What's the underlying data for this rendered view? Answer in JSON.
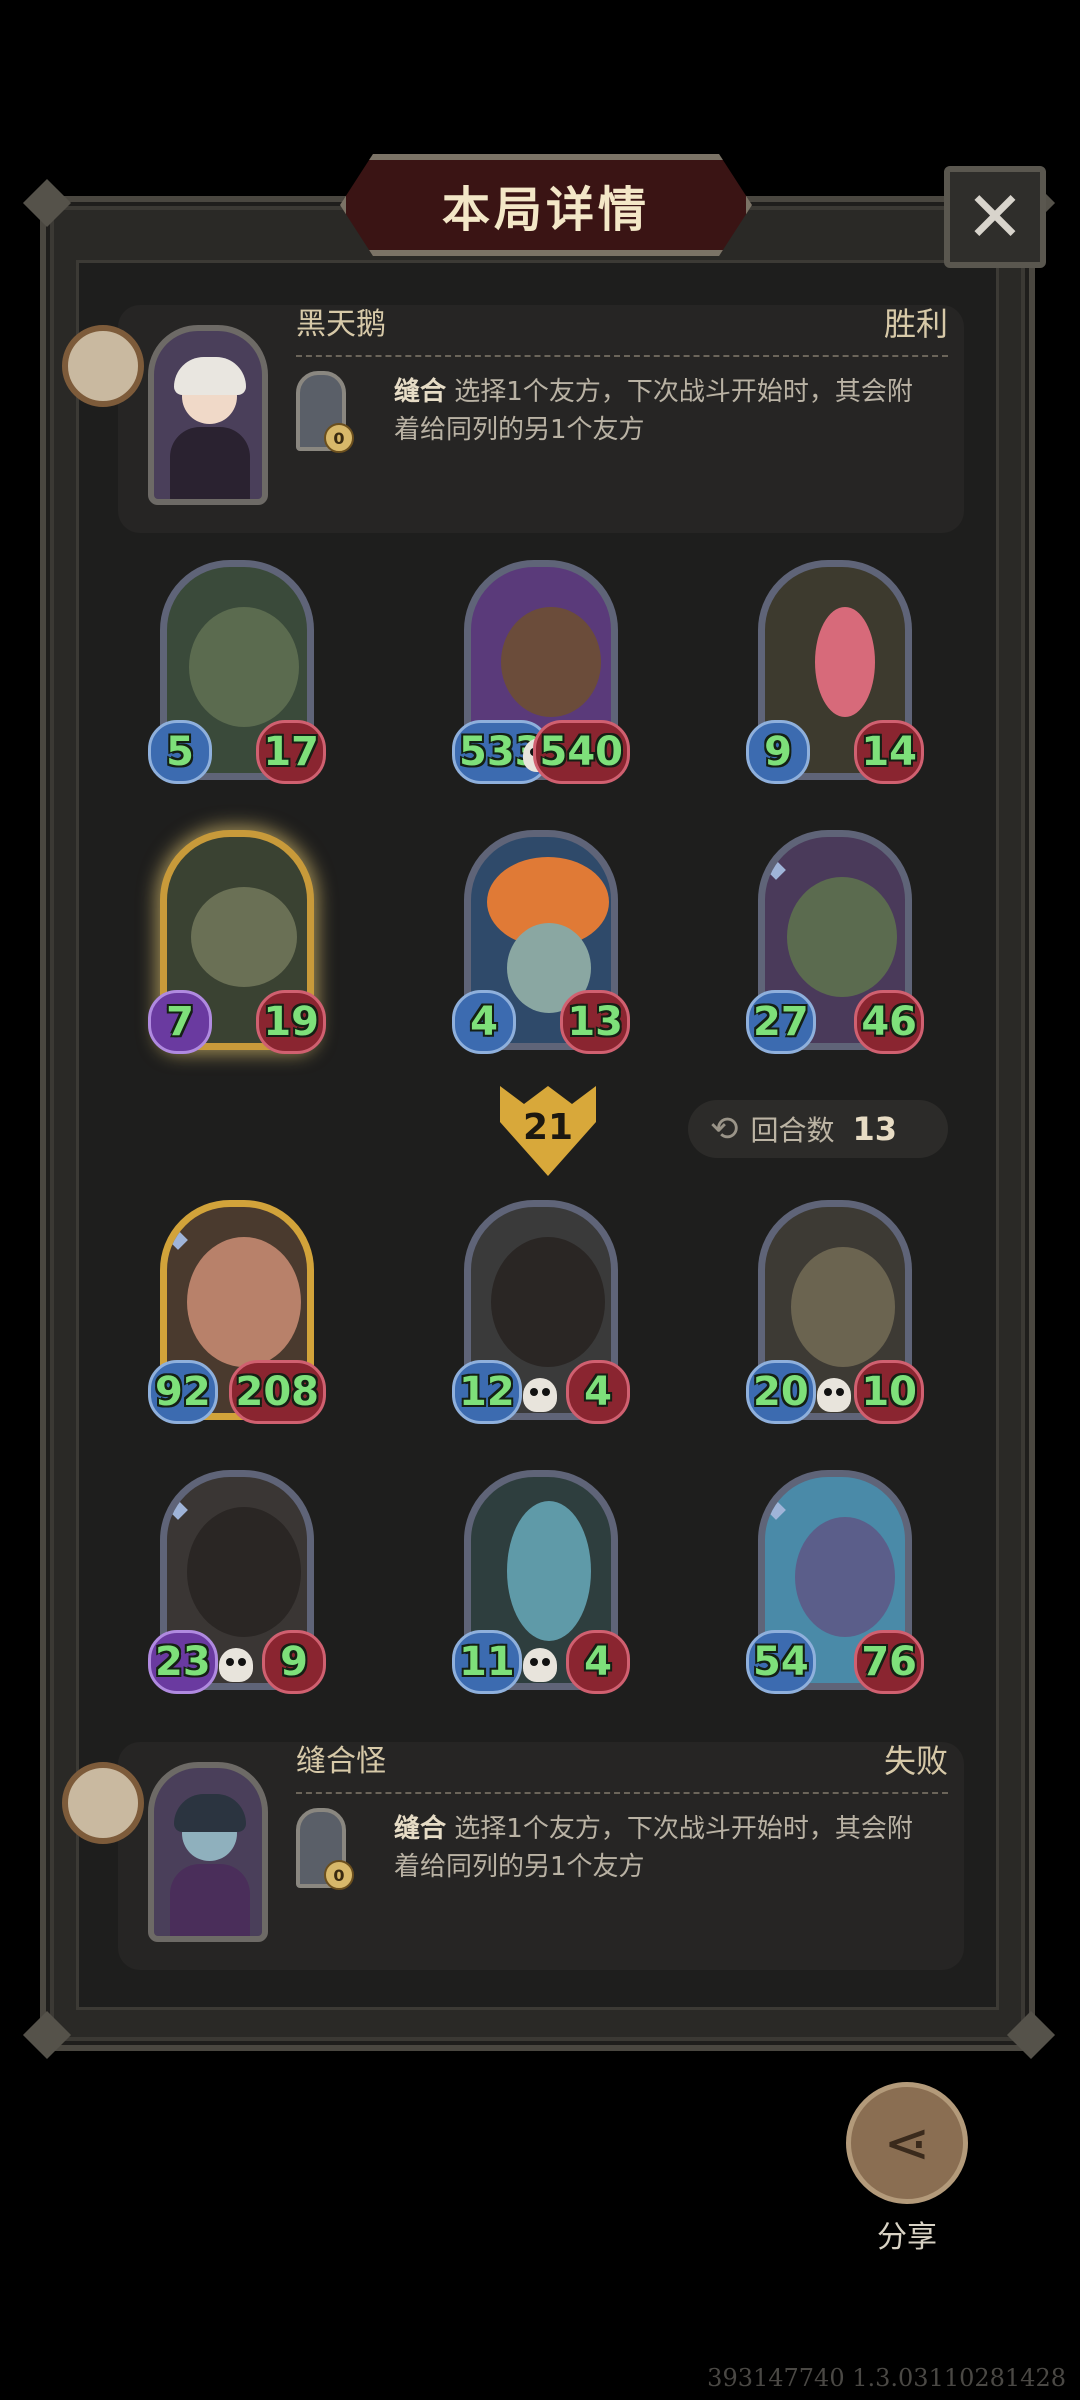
{
  "title": "本局详情",
  "close_icon": "✕",
  "top_player": {
    "name": "黑天鹅",
    "result": "胜利",
    "skill_name": "缝合",
    "skill_desc": "选择1个友方，下次战斗开始时，其会附着给同列的另1个友方",
    "skill_charges": "0"
  },
  "top_board": [
    {
      "atk": "5",
      "hp": "17"
    },
    {
      "atk": "533",
      "hp": "540"
    },
    {
      "atk": "9",
      "hp": "14"
    },
    {
      "atk": "7",
      "hp": "19"
    },
    {
      "atk": "4",
      "hp": "13"
    },
    {
      "atk": "27",
      "hp": "46"
    }
  ],
  "round_marker": "21",
  "turn_count": {
    "label": "回合数",
    "value": "13"
  },
  "bottom_board": [
    {
      "atk": "92",
      "hp": "208"
    },
    {
      "atk": "12",
      "hp": "4"
    },
    {
      "atk": "20",
      "hp": "10"
    },
    {
      "atk": "23",
      "hp": "9"
    },
    {
      "atk": "11",
      "hp": "4"
    },
    {
      "atk": "54",
      "hp": "76"
    }
  ],
  "bottom_player": {
    "name": "缝合怪",
    "result": "失败",
    "skill_name": "缝合",
    "skill_desc": "选择1个友方，下次战斗开始时，其会附着给同列的另1个友方",
    "skill_charges": "0"
  },
  "share": {
    "label": "分享",
    "icon": "share-icon"
  },
  "version": "393147740 1.3.03110281428"
}
